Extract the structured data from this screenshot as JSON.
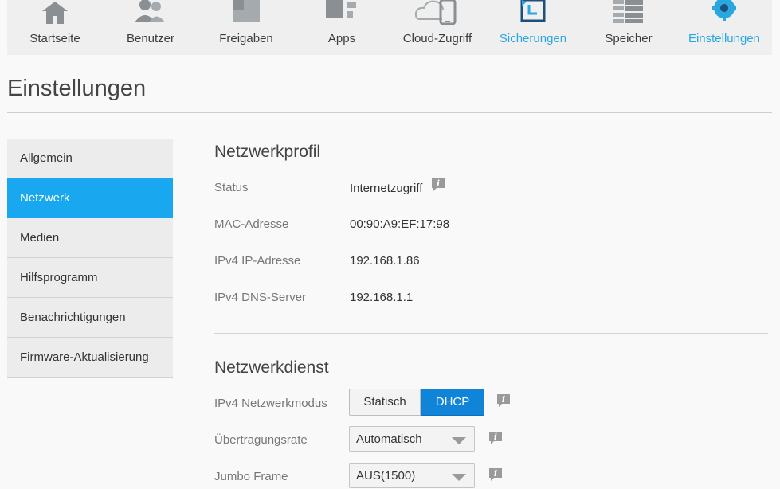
{
  "topnav": {
    "items": [
      {
        "label": "Startseite",
        "icon": "home-icon"
      },
      {
        "label": "Benutzer",
        "icon": "users-icon"
      },
      {
        "label": "Freigaben",
        "icon": "shares-icon"
      },
      {
        "label": "Apps",
        "icon": "apps-icon"
      },
      {
        "label": "Cloud-Zugriff",
        "icon": "cloud-access-icon"
      },
      {
        "label": "Sicherungen",
        "icon": "backup-icon"
      },
      {
        "label": "Speicher",
        "icon": "storage-icon"
      },
      {
        "label": "Einstellungen",
        "icon": "gear-icon"
      }
    ]
  },
  "page": {
    "title": "Einstellungen"
  },
  "sidebar": {
    "items": [
      {
        "label": "Allgemein"
      },
      {
        "label": "Netzwerk",
        "active": true
      },
      {
        "label": "Medien"
      },
      {
        "label": "Hilfsprogramm"
      },
      {
        "label": "Benachrichtigungen"
      },
      {
        "label": "Firmware-Aktualisierung"
      }
    ]
  },
  "profile": {
    "title": "Netzwerkprofil",
    "rows": [
      {
        "label": "Status",
        "value": "Internetzugriff"
      },
      {
        "label": "MAC-Adresse",
        "value": "00:90:A9:EF:17:98"
      },
      {
        "label": "IPv4 IP-Adresse",
        "value": "192.168.1.86"
      },
      {
        "label": "IPv4 DNS-Server",
        "value": "192.168.1.1"
      }
    ]
  },
  "service": {
    "title": "Netzwerkdienst",
    "mode_label": "IPv4 Netzwerkmodus",
    "mode_static": "Statisch",
    "mode_dhcp": "DHCP",
    "rate_label": "Übertragungsrate",
    "rate_value": "Automatisch",
    "jumbo_label": "Jumbo Frame",
    "jumbo_value": "AUS(1500)"
  },
  "colors": {
    "accent": "#19a8ef",
    "active_nav": "#2aa6e0",
    "dhcp_button": "#0f84d9",
    "nav_icon": "#8a8f94"
  }
}
